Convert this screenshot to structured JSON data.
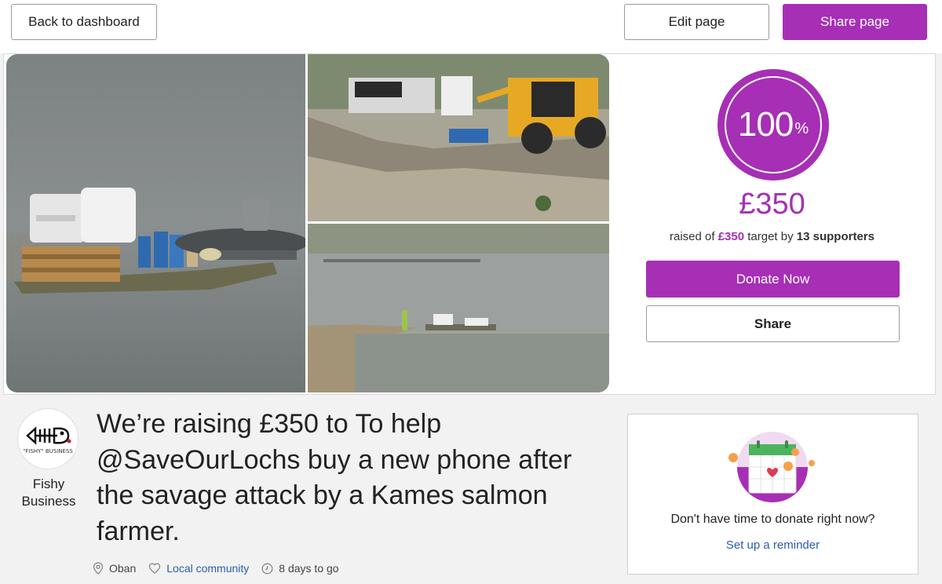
{
  "header": {
    "back_label": "Back to dashboard",
    "edit_label": "Edit page",
    "share_page_label": "Share page"
  },
  "progress": {
    "percent": "100",
    "percent_sign": "%",
    "raised_amount": "£350",
    "raised_prefix": "raised of ",
    "target_amount": "£350",
    "target_mid": " target by ",
    "supporters": "13 supporters",
    "donate_label": "Donate Now",
    "share_label": "Share"
  },
  "campaign": {
    "title": "We’re raising £350 to To help @SaveOurLochs buy a new phone after the savage attack by a Kames salmon farmer.",
    "owner_name": "Fishy Business",
    "avatar_tagline": "\"FISHY\" BUSINESS",
    "location": "Oban",
    "category": "Local community",
    "time_left": "8 days to go"
  },
  "reminder": {
    "prompt": "Don't have time to donate right now?",
    "link_label": "Set up a reminder"
  },
  "colors": {
    "brand_purple": "#a62fb5",
    "link_blue": "#2a5db0"
  },
  "icons": {
    "location": "map-pin-icon",
    "category": "heart-icon",
    "time": "clock-icon",
    "reminder": "calendar-heart-icon"
  }
}
